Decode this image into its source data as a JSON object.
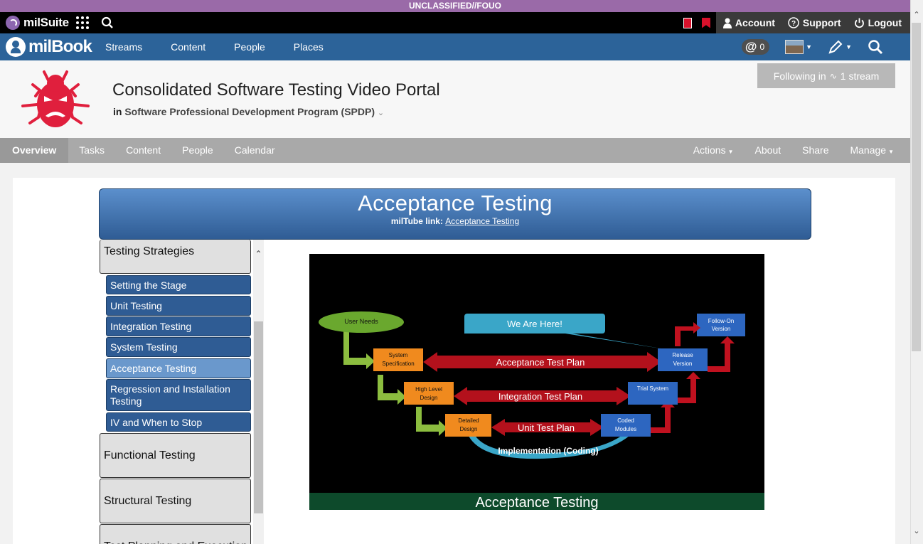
{
  "classification": "UNCLASSIFIED//FOUO",
  "topbar": {
    "brand": "milSuite",
    "account": "Account",
    "support": "Support",
    "logout": "Logout"
  },
  "navbar": {
    "brand": "milBook",
    "links": [
      "Streams",
      "Content",
      "People",
      "Places"
    ],
    "mentions_count": "0"
  },
  "place": {
    "title": "Consolidated Software Testing Video Portal",
    "in_label": "in",
    "group": "Software Professional Development Program (SPDP)",
    "following_label": "Following in",
    "following_stream": "1 stream"
  },
  "subnav": {
    "left": [
      "Overview",
      "Tasks",
      "Content",
      "People",
      "Calendar"
    ],
    "right": [
      "Actions",
      "About",
      "Share",
      "Manage"
    ]
  },
  "banner": {
    "title": "Acceptance Testing",
    "link_label": "milTube link:",
    "link_text": "Acceptance Testing"
  },
  "sidebar": {
    "section1": "Testing Strategies",
    "items": [
      "Setting the Stage",
      "Unit Testing",
      "Integration Testing",
      "System Testing",
      "Acceptance Testing",
      "Regression and Installation Testing",
      "IV and When to Stop"
    ],
    "section2": "Functional Testing",
    "section3": "Structural Testing",
    "section4": "Test Planning and Execution"
  },
  "slide": {
    "user_needs": "User Needs",
    "we_are_here": "We Are Here!",
    "follow_on": [
      "Follow-On",
      "Version"
    ],
    "system_spec": [
      "System",
      "Specification"
    ],
    "acceptance_plan": "Acceptance Test Plan",
    "release": [
      "Release",
      "Version"
    ],
    "high_level": [
      "High Level",
      "Design"
    ],
    "integration_plan": "Integration Test Plan",
    "trial_system": "Trial System",
    "detailed": [
      "Detailed",
      "Design"
    ],
    "unit_plan": "Unit Test Plan",
    "coded": [
      "Coded",
      "Modules"
    ],
    "implementation": "Implementation (Coding)",
    "footer": "Acceptance Testing"
  },
  "colors": {
    "classification_bar": "#9a6aa8",
    "nav_blue": "#2c6399",
    "banner_blue": "#2f5c94",
    "active_item": "#6a98cc",
    "bug_red": "#e01f3d"
  }
}
